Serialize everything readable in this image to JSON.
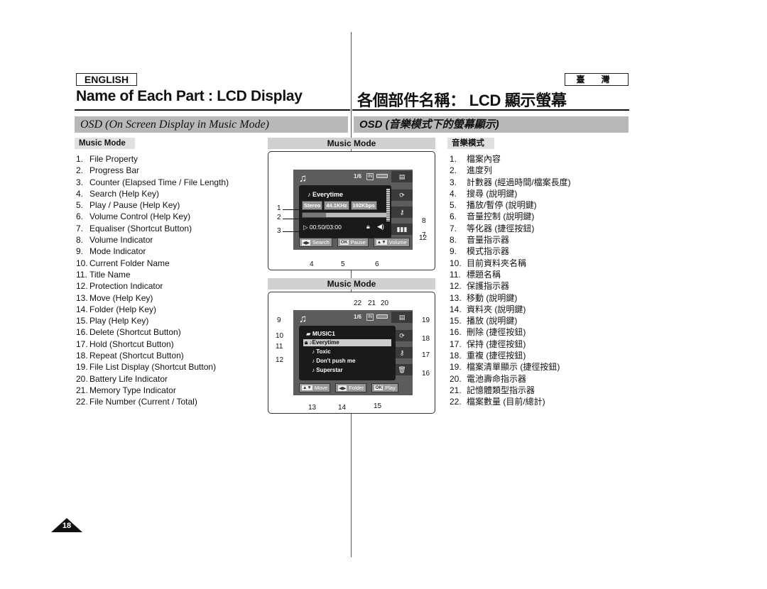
{
  "header": {
    "lang_en": "ENGLISH",
    "lang_tw": "臺 灣",
    "title_en": "Name of Each Part : LCD Display",
    "title_tw": "各個部件名稱： LCD 顯示螢幕",
    "section_en": "OSD (On Screen Display in Music Mode)",
    "section_tw": "OSD (音樂模式下的螢幕顯示)"
  },
  "list_en": {
    "label": "Music Mode",
    "items": [
      {
        "num": "1.",
        "text": "File Property"
      },
      {
        "num": "2.",
        "text": "Progress Bar"
      },
      {
        "num": "3.",
        "text": "Counter (Elapsed Time / File Length)"
      },
      {
        "num": "4.",
        "text": "Search (Help Key)"
      },
      {
        "num": "5.",
        "text": "Play / Pause (Help Key)"
      },
      {
        "num": "6.",
        "text": "Volume Control (Help Key)"
      },
      {
        "num": "7.",
        "text": "Equaliser (Shortcut Button)"
      },
      {
        "num": "8.",
        "text": "Volume Indicator"
      },
      {
        "num": "9.",
        "text": "Mode Indicator"
      },
      {
        "num": "10.",
        "text": "Current Folder Name"
      },
      {
        "num": "11.",
        "text": "Title Name"
      },
      {
        "num": "12.",
        "text": "Protection Indicator"
      },
      {
        "num": "13.",
        "text": "Move (Help Key)"
      },
      {
        "num": "14.",
        "text": "Folder (Help Key)"
      },
      {
        "num": "15.",
        "text": "Play (Help Key)"
      },
      {
        "num": "16.",
        "text": "Delete (Shortcut Button)"
      },
      {
        "num": "17.",
        "text": "Hold (Shortcut Button)"
      },
      {
        "num": "18.",
        "text": "Repeat (Shortcut Button)"
      },
      {
        "num": "19.",
        "text": "File List Display (Shortcut Button)"
      },
      {
        "num": "20.",
        "text": "Battery Life Indicator"
      },
      {
        "num": "21.",
        "text": "Memory Type Indicator"
      },
      {
        "num": "22.",
        "text": "File Number (Current / Total)"
      }
    ]
  },
  "list_tw": {
    "label": "音樂模式",
    "items": [
      {
        "num": "1.",
        "text": "檔案內容"
      },
      {
        "num": "2.",
        "text": "進度列"
      },
      {
        "num": "3.",
        "text": "計數器 (經過時間/檔案長度)"
      },
      {
        "num": "4.",
        "text": "搜尋 (說明鍵)"
      },
      {
        "num": "5.",
        "text": "播放/暫停 (說明鍵)"
      },
      {
        "num": "6.",
        "text": "音量控制 (說明鍵)"
      },
      {
        "num": "7.",
        "text": "等化器 (捷徑按鈕)"
      },
      {
        "num": "8.",
        "text": "音量指示器"
      },
      {
        "num": "9.",
        "text": "模式指示器"
      },
      {
        "num": "10.",
        "text": "目前資料夾名稱"
      },
      {
        "num": "11.",
        "text": "標題名稱"
      },
      {
        "num": "12.",
        "text": "保護指示器"
      },
      {
        "num": "13.",
        "text": "移動 (說明鍵)"
      },
      {
        "num": "14.",
        "text": "資料夾 (說明鍵)"
      },
      {
        "num": "15.",
        "text": "播放 (說明鍵)"
      },
      {
        "num": "16.",
        "text": "刪除 (捷徑按鈕)"
      },
      {
        "num": "17.",
        "text": "保持 (捷徑按鈕)"
      },
      {
        "num": "18.",
        "text": "重複 (捷徑按鈕)"
      },
      {
        "num": "19.",
        "text": "檔案清單顯示 (捷徑按鈕)"
      },
      {
        "num": "20.",
        "text": "電池壽命指示器"
      },
      {
        "num": "21.",
        "text": "記憶體類型指示器"
      },
      {
        "num": "22.",
        "text": "檔案數量 (目前/總計)"
      }
    ]
  },
  "screen1": {
    "title": "Music Mode",
    "mode_icon": "♫",
    "file_number": "1/6",
    "memory": "IN",
    "song": "Everytime",
    "props": [
      "Stereo",
      "44.1KHz",
      "192Kbps"
    ],
    "progress": 0.28,
    "counter": "00:50/03:00",
    "side_buttons": [
      "list-icon",
      "repeat-icon",
      "hold-icon",
      "equaliser-icon"
    ],
    "help_keys": [
      {
        "glyph": "◀▶",
        "label": "Search"
      },
      {
        "glyph": "OK",
        "label": "Pause"
      },
      {
        "glyph": "▲▼",
        "label": "Volume"
      }
    ],
    "callouts": [
      "1",
      "2",
      "3",
      "4",
      "5",
      "6",
      "7",
      "8",
      "12"
    ]
  },
  "screen2": {
    "title": "Music Mode",
    "mode_icon": "♫",
    "file_number": "1/6",
    "memory": "IN",
    "folder": "MUSIC1",
    "files": [
      "Everytime",
      "Toxic",
      "Don't push me",
      "Superstar"
    ],
    "selected_index": 0,
    "side_buttons": [
      "list-icon",
      "repeat-icon",
      "hold-icon",
      "delete-icon"
    ],
    "help_keys": [
      {
        "glyph": "▲▼",
        "label": "Move"
      },
      {
        "glyph": "◀▶",
        "label": "Folder"
      },
      {
        "glyph": "OK",
        "label": "Play"
      }
    ],
    "callouts": [
      "9",
      "10",
      "11",
      "12",
      "13",
      "14",
      "15",
      "16",
      "17",
      "18",
      "19",
      "20",
      "21",
      "22"
    ]
  },
  "page_number": "18"
}
